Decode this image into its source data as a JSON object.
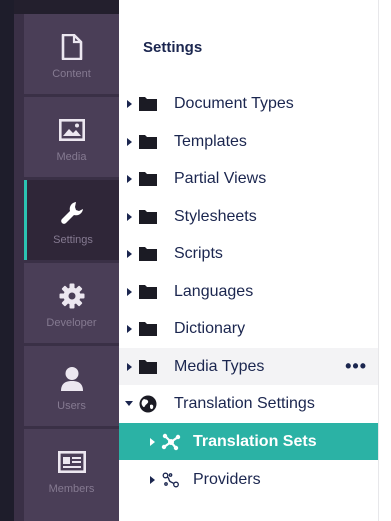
{
  "sections": [
    {
      "label": "Content",
      "icon": "document-icon"
    },
    {
      "label": "Media",
      "icon": "image-icon"
    },
    {
      "label": "Settings",
      "icon": "wrench-icon",
      "active": true
    },
    {
      "label": "Developer",
      "icon": "gear-icon"
    },
    {
      "label": "Users",
      "icon": "user-icon"
    },
    {
      "label": "Members",
      "icon": "id-card-icon"
    }
  ],
  "tree": {
    "title": "Settings",
    "items": [
      {
        "label": "Document Types",
        "icon": "folder-icon"
      },
      {
        "label": "Templates",
        "icon": "folder-icon"
      },
      {
        "label": "Partial Views",
        "icon": "folder-icon"
      },
      {
        "label": "Stylesheets",
        "icon": "folder-icon"
      },
      {
        "label": "Scripts",
        "icon": "folder-icon"
      },
      {
        "label": "Languages",
        "icon": "folder-icon"
      },
      {
        "label": "Dictionary",
        "icon": "folder-icon"
      },
      {
        "label": "Media Types",
        "icon": "folder-icon",
        "more": "•••"
      },
      {
        "label": "Translation Settings",
        "icon": "globe-icon",
        "expanded": true
      },
      {
        "label": "Translation Sets",
        "icon": "network-icon",
        "selected": true
      },
      {
        "label": "Providers",
        "icon": "connection-icon"
      }
    ]
  },
  "colors": {
    "accent": "#2bb2a5",
    "sidebar_bg": "#3a3046",
    "sidebar_item_bg": "#4a3e57",
    "text_dark": "#1b264f"
  }
}
